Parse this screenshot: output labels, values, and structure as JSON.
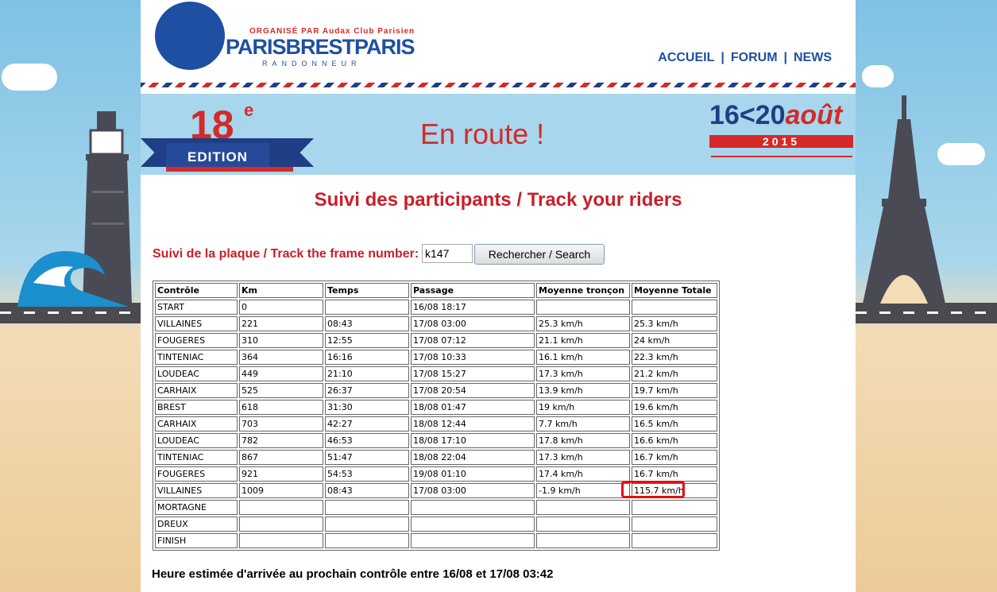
{
  "header": {
    "logo_org": "ORGANISÉ PAR Audax Club Parisien",
    "logo_main": "PARISBRESTPARIS",
    "logo_sub": "RANDONNEUR",
    "nav": [
      {
        "label": "ACCUEIL"
      },
      {
        "label": "FORUM"
      },
      {
        "label": "NEWS"
      }
    ],
    "nav_sep": "|"
  },
  "banner": {
    "edition_number": "18",
    "edition_sup": "e",
    "edition_label": "EDITION",
    "center_text": "En route !",
    "dates": "16<20",
    "month": "août",
    "year": "2015"
  },
  "page": {
    "title": "Suivi des participants / Track your riders",
    "search_label": "Suivi de la plaque / Track the frame number:",
    "search_value": "k147",
    "search_button": "Rechercher / Search",
    "eta": "Heure estimée d'arrivée au prochain contrôle entre 16/08 et 17/08 03:42"
  },
  "table": {
    "headers": [
      "Contrôle",
      "Km",
      "Temps",
      "Passage",
      "Moyenne tronçon",
      "Moyenne Totale"
    ],
    "rows": [
      [
        "START",
        "0",
        "",
        "16/08 18:17",
        "",
        ""
      ],
      [
        "VILLAINES",
        "221",
        "08:43",
        "17/08 03:00",
        "25.3 km/h",
        "25.3 km/h"
      ],
      [
        "FOUGERES",
        "310",
        "12:55",
        "17/08 07:12",
        "21.1 km/h",
        "24 km/h"
      ],
      [
        "TINTENIAC",
        "364",
        "16:16",
        "17/08 10:33",
        "16.1 km/h",
        "22.3 km/h"
      ],
      [
        "LOUDEAC",
        "449",
        "21:10",
        "17/08 15:27",
        "17.3 km/h",
        "21.2 km/h"
      ],
      [
        "CARHAIX",
        "525",
        "26:37",
        "17/08 20:54",
        "13.9 km/h",
        "19.7 km/h"
      ],
      [
        "BREST",
        "618",
        "31:30",
        "18/08 01:47",
        "19 km/h",
        "19.6 km/h"
      ],
      [
        "CARHAIX",
        "703",
        "42:27",
        "18/08 12:44",
        "7.7 km/h",
        "16.5 km/h"
      ],
      [
        "LOUDEAC",
        "782",
        "46:53",
        "18/08 17:10",
        "17.8 km/h",
        "16.6 km/h"
      ],
      [
        "TINTENIAC",
        "867",
        "51:47",
        "18/08 22:04",
        "17.3 km/h",
        "16.7 km/h"
      ],
      [
        "FOUGERES",
        "921",
        "54:53",
        "19/08 01:10",
        "17.4 km/h",
        "16.7 km/h"
      ],
      [
        "VILLAINES",
        "1009",
        "08:43",
        "17/08 03:00",
        "-1.9 km/h",
        "115.7 km/h"
      ],
      [
        "MORTAGNE",
        "",
        "",
        "",
        "",
        ""
      ],
      [
        "DREUX",
        "",
        "",
        "",
        "",
        ""
      ],
      [
        "FINISH",
        "",
        "",
        "",
        "",
        ""
      ]
    ]
  },
  "colors": {
    "accent_red": "#c8202a",
    "brand_blue": "#1f4fa3",
    "highlight_box": "#e01010"
  }
}
